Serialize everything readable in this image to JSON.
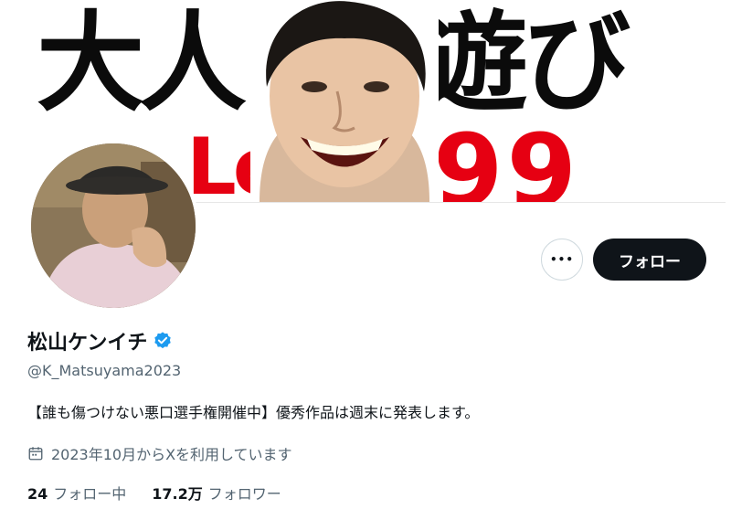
{
  "banner": {
    "text_left": "大人",
    "text_right": "遊び",
    "text_red_left": "Level",
    "text_red_right": "99"
  },
  "profile": {
    "display_name": "松山ケンイチ",
    "verified": true,
    "handle": "@K_Matsuyama2023",
    "bio": "【誰も傷つけない悪口選手権開催中】優秀作品は週末に発表します。",
    "joined": "2023年10月からXを利用しています",
    "following_count": "24",
    "following_label": "フォロー中",
    "followers_count": "17.2万",
    "followers_label": "フォロワー"
  },
  "actions": {
    "more_label": "•••",
    "follow_label": "フォロー"
  },
  "colors": {
    "accent": "#1d9bf0",
    "button_dark": "#0f1419",
    "banner_red": "#e60012"
  },
  "icons": [
    "more-icon",
    "verified-badge-icon",
    "calendar-icon"
  ]
}
